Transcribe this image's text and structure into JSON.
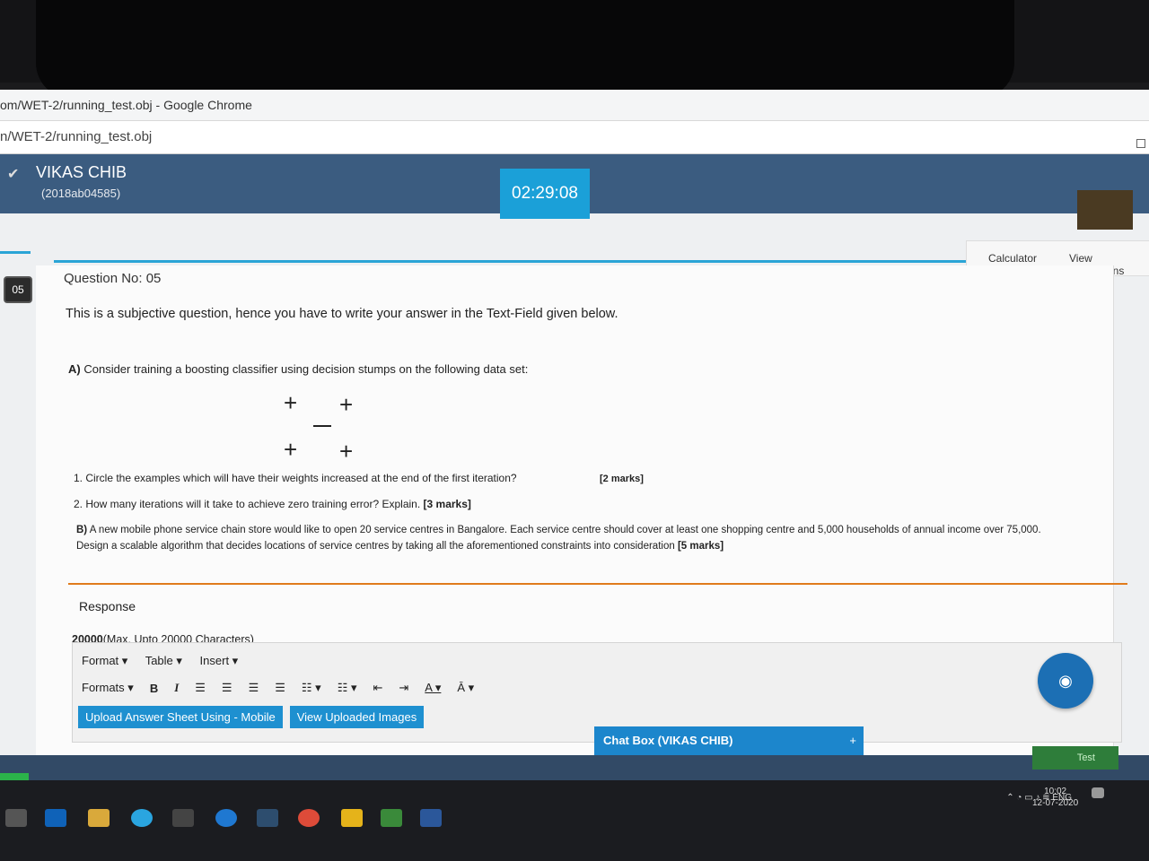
{
  "browser": {
    "window_title": "om/WET-2/running_test.obj - Google Chrome",
    "url": "n/WET-2/running_test.obj"
  },
  "header": {
    "candidate_name": "VIKAS CHIB",
    "candidate_id": "(2018ab04585)",
    "timer": "02:29:08"
  },
  "top_links": {
    "calculator": "Calculator",
    "view_instructions": "View Instructions"
  },
  "question": {
    "badge": "05",
    "number_label": "Question No: 05",
    "note": "This is a subjective question, hence you have to write your answer in the Text-Field given below.",
    "part_a_prefix": "A)",
    "part_a": "Consider training a boosting classifier using decision stumps on the following data set:",
    "plus_symbol": "+",
    "item1": "1. Circle the examples which will have their weights increased at the end of the first iteration?",
    "item1_marks": "[2 marks]",
    "item2": "2. How many iterations will it take to achieve zero training error? Explain.",
    "item2_marks": "[3 marks]",
    "part_b_prefix": "B)",
    "part_b_line1": "A new mobile phone service chain store would like to open 20 service centres in Bangalore.  Each service centre should cover at least one shopping centre and 5,000 households of annual income over 75,000.",
    "part_b_line2": "Design a scalable algorithm that decides locations of service centres by taking all the aforementioned constraints into consideration",
    "part_b_marks": "[5 marks]"
  },
  "response": {
    "label": "Response",
    "char_count": "20000",
    "char_limit": "(Max. Upto 20000 Characters)",
    "menu": [
      "Format ▾",
      "Table ▾",
      "Insert ▾"
    ],
    "formats": "Formats ▾",
    "upload_button": "Upload Answer Sheet Using - Mobile",
    "view_button": "View Uploaded Images"
  },
  "chat": {
    "label": "Chat Box (VIKAS CHIB)",
    "toggle": "+"
  },
  "footer": {
    "end_test": "Test"
  },
  "system_tray": {
    "language": "ENG",
    "time": "10:02",
    "date": "12-07-2020"
  },
  "colors": {
    "header": "#3b5c80",
    "accent": "#1ba0d8",
    "separator": "#e07b1c"
  }
}
